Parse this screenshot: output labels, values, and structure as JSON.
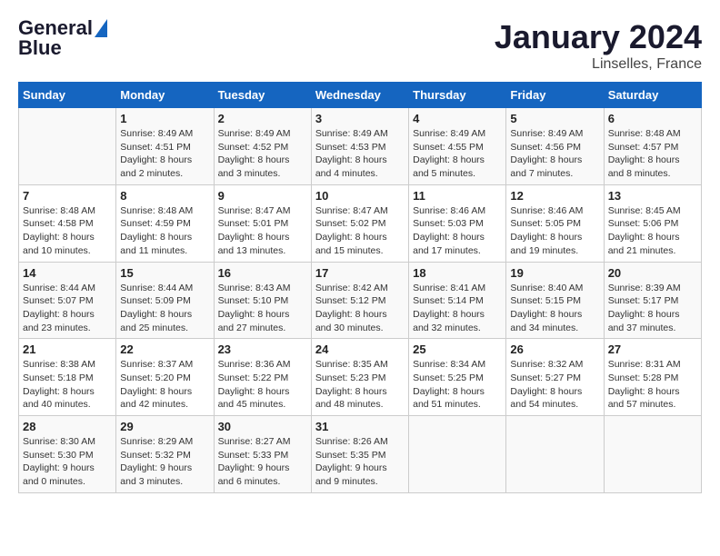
{
  "logo": {
    "line1": "General",
    "line2": "Blue"
  },
  "title": "January 2024",
  "subtitle": "Linselles, France",
  "days_of_week": [
    "Sunday",
    "Monday",
    "Tuesday",
    "Wednesday",
    "Thursday",
    "Friday",
    "Saturday"
  ],
  "weeks": [
    [
      {
        "day": "",
        "info": ""
      },
      {
        "day": "1",
        "info": "Sunrise: 8:49 AM\nSunset: 4:51 PM\nDaylight: 8 hours\nand 2 minutes."
      },
      {
        "day": "2",
        "info": "Sunrise: 8:49 AM\nSunset: 4:52 PM\nDaylight: 8 hours\nand 3 minutes."
      },
      {
        "day": "3",
        "info": "Sunrise: 8:49 AM\nSunset: 4:53 PM\nDaylight: 8 hours\nand 4 minutes."
      },
      {
        "day": "4",
        "info": "Sunrise: 8:49 AM\nSunset: 4:55 PM\nDaylight: 8 hours\nand 5 minutes."
      },
      {
        "day": "5",
        "info": "Sunrise: 8:49 AM\nSunset: 4:56 PM\nDaylight: 8 hours\nand 7 minutes."
      },
      {
        "day": "6",
        "info": "Sunrise: 8:48 AM\nSunset: 4:57 PM\nDaylight: 8 hours\nand 8 minutes."
      }
    ],
    [
      {
        "day": "7",
        "info": "Sunrise: 8:48 AM\nSunset: 4:58 PM\nDaylight: 8 hours\nand 10 minutes."
      },
      {
        "day": "8",
        "info": "Sunrise: 8:48 AM\nSunset: 4:59 PM\nDaylight: 8 hours\nand 11 minutes."
      },
      {
        "day": "9",
        "info": "Sunrise: 8:47 AM\nSunset: 5:01 PM\nDaylight: 8 hours\nand 13 minutes."
      },
      {
        "day": "10",
        "info": "Sunrise: 8:47 AM\nSunset: 5:02 PM\nDaylight: 8 hours\nand 15 minutes."
      },
      {
        "day": "11",
        "info": "Sunrise: 8:46 AM\nSunset: 5:03 PM\nDaylight: 8 hours\nand 17 minutes."
      },
      {
        "day": "12",
        "info": "Sunrise: 8:46 AM\nSunset: 5:05 PM\nDaylight: 8 hours\nand 19 minutes."
      },
      {
        "day": "13",
        "info": "Sunrise: 8:45 AM\nSunset: 5:06 PM\nDaylight: 8 hours\nand 21 minutes."
      }
    ],
    [
      {
        "day": "14",
        "info": "Sunrise: 8:44 AM\nSunset: 5:07 PM\nDaylight: 8 hours\nand 23 minutes."
      },
      {
        "day": "15",
        "info": "Sunrise: 8:44 AM\nSunset: 5:09 PM\nDaylight: 8 hours\nand 25 minutes."
      },
      {
        "day": "16",
        "info": "Sunrise: 8:43 AM\nSunset: 5:10 PM\nDaylight: 8 hours\nand 27 minutes."
      },
      {
        "day": "17",
        "info": "Sunrise: 8:42 AM\nSunset: 5:12 PM\nDaylight: 8 hours\nand 30 minutes."
      },
      {
        "day": "18",
        "info": "Sunrise: 8:41 AM\nSunset: 5:14 PM\nDaylight: 8 hours\nand 32 minutes."
      },
      {
        "day": "19",
        "info": "Sunrise: 8:40 AM\nSunset: 5:15 PM\nDaylight: 8 hours\nand 34 minutes."
      },
      {
        "day": "20",
        "info": "Sunrise: 8:39 AM\nSunset: 5:17 PM\nDaylight: 8 hours\nand 37 minutes."
      }
    ],
    [
      {
        "day": "21",
        "info": "Sunrise: 8:38 AM\nSunset: 5:18 PM\nDaylight: 8 hours\nand 40 minutes."
      },
      {
        "day": "22",
        "info": "Sunrise: 8:37 AM\nSunset: 5:20 PM\nDaylight: 8 hours\nand 42 minutes."
      },
      {
        "day": "23",
        "info": "Sunrise: 8:36 AM\nSunset: 5:22 PM\nDaylight: 8 hours\nand 45 minutes."
      },
      {
        "day": "24",
        "info": "Sunrise: 8:35 AM\nSunset: 5:23 PM\nDaylight: 8 hours\nand 48 minutes."
      },
      {
        "day": "25",
        "info": "Sunrise: 8:34 AM\nSunset: 5:25 PM\nDaylight: 8 hours\nand 51 minutes."
      },
      {
        "day": "26",
        "info": "Sunrise: 8:32 AM\nSunset: 5:27 PM\nDaylight: 8 hours\nand 54 minutes."
      },
      {
        "day": "27",
        "info": "Sunrise: 8:31 AM\nSunset: 5:28 PM\nDaylight: 8 hours\nand 57 minutes."
      }
    ],
    [
      {
        "day": "28",
        "info": "Sunrise: 8:30 AM\nSunset: 5:30 PM\nDaylight: 9 hours\nand 0 minutes."
      },
      {
        "day": "29",
        "info": "Sunrise: 8:29 AM\nSunset: 5:32 PM\nDaylight: 9 hours\nand 3 minutes."
      },
      {
        "day": "30",
        "info": "Sunrise: 8:27 AM\nSunset: 5:33 PM\nDaylight: 9 hours\nand 6 minutes."
      },
      {
        "day": "31",
        "info": "Sunrise: 8:26 AM\nSunset: 5:35 PM\nDaylight: 9 hours\nand 9 minutes."
      },
      {
        "day": "",
        "info": ""
      },
      {
        "day": "",
        "info": ""
      },
      {
        "day": "",
        "info": ""
      }
    ]
  ]
}
